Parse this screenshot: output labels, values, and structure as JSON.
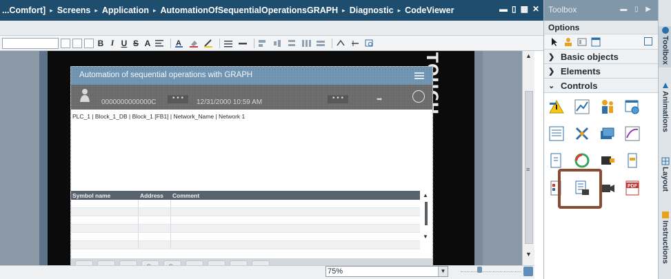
{
  "breadcrumb": {
    "items": [
      "...Comfort]",
      "Screens",
      "Application",
      "AutomationOfSequentialOperationsGRAPH",
      "Diagnostic",
      "CodeViewer"
    ],
    "separator": "▸"
  },
  "window_controls": [
    "▬",
    "▯",
    "▦",
    "✕"
  ],
  "format_toolbar": {
    "bold": "B",
    "italic": "I",
    "underline": "U",
    "strikethrough": "S",
    "font_size": "A"
  },
  "device": {
    "touch_label": "TOUCH"
  },
  "hmi_screen": {
    "title": "Automation of sequential operations with GRAPH",
    "status_id": "0000000000000C",
    "status_dots": "• • •",
    "status_date": "12/31/2000 10:59 AM",
    "status_dots2": "• • •",
    "status_arrow": "➥",
    "network_path": "PLC_1 | Block_1_DB | Block_1 [FB1] | Network_Name | Network 1",
    "symbol_table": {
      "columns": [
        "Symbol name",
        "Address",
        "Comment"
      ]
    },
    "buttons": [
      "☺",
      "↱",
      "↜",
      "🔍",
      "🔍",
      "▤",
      "▤",
      "⁰⁄₁",
      "⁰⁄A"
    ]
  },
  "zoom": {
    "value": "75%",
    "slider_level": 0.3
  },
  "toolbox": {
    "title": "Toolbox",
    "options_title": "Options",
    "panes": [
      {
        "label": "Basic objects",
        "expanded": false
      },
      {
        "label": "Elements",
        "expanded": false
      },
      {
        "label": "Controls",
        "expanded": true
      }
    ]
  },
  "side_tabs": [
    "Toolbox",
    "Animations",
    "Layout",
    "Instructions"
  ],
  "colors": {
    "titlebar": "#1f4d6d",
    "highlight": "#8b4a32",
    "hmi_title": "#6d93b0"
  }
}
